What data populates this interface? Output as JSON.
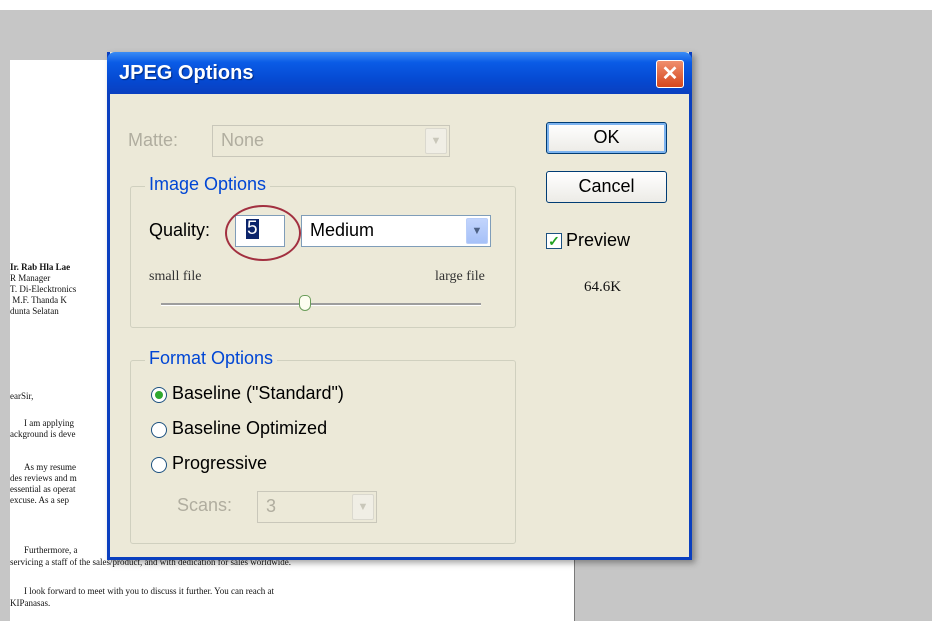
{
  "document": {
    "lines": [
      "Ir. Rab Hla Lae",
      "R Manager",
      "T. Di-Elecktronics",
      " M.F. Thanda K",
      "dunta Selatan",
      "earSir,",
      "I am applying",
      "ackground is deve",
      "As my resume",
      "des reviews and m",
      "essential as operat",
      "excuse. As a sep",
      "Furthermore, a",
      "servicing a staff of the sales/product, and with dedication for sales worldwide.",
      "I look forward to meet with you to discuss it further. You can reach at",
      "KIPanasas."
    ]
  },
  "dialog": {
    "title": "JPEG Options",
    "close_label": "✕",
    "matte": {
      "label": "Matte:",
      "value": "None"
    },
    "image_options": {
      "title": "Image Options",
      "quality_label": "Quality:",
      "quality_value": "5",
      "quality_preset": "Medium",
      "small_file": "small file",
      "large_file": "large file",
      "slider_fraction": 0.45
    },
    "format_options": {
      "title": "Format Options",
      "options": [
        "Baseline (\"Standard\")",
        "Baseline Optimized",
        "Progressive"
      ],
      "selected_index": 0,
      "scans_label": "Scans:",
      "scans_value": "3"
    },
    "ok_label": "OK",
    "cancel_label": "Cancel",
    "preview_label": "Preview",
    "preview_checked": true,
    "file_size": "64.6K"
  },
  "icons": {
    "dropdown": "chevron-down-icon",
    "close": "close-icon",
    "check": "checkmark-icon"
  }
}
